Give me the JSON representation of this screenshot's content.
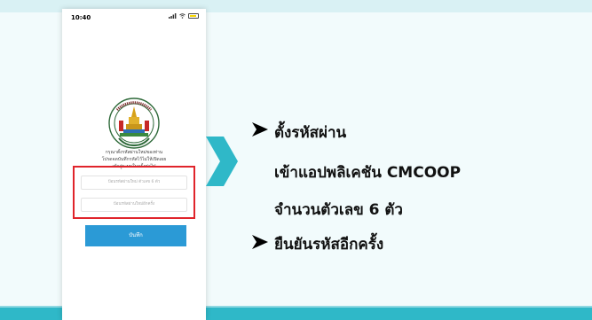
{
  "status_bar": {
    "time": "10:40"
  },
  "form": {
    "instruction_lines": [
      "กรุณาตั้งรหัสผ่านใหม่ของท่าน",
      "โปรดจดบันทึกรหัสไว้ไม่ให้เปิดเผย",
      "เข้าสู่ระบบในครั้งต่อไป"
    ],
    "password_placeholder": "ป้อนรหัสผ่านใหม่ ตัวเลข 6 ตัว",
    "confirm_placeholder": "ป้อนรหัสผ่านใหม่อีกครั้ง",
    "save_label": "บันทึก"
  },
  "steps": {
    "step1_line1": "ตั้งรหัสผ่าน",
    "step1_line2": "เข้าแอปพลิเคชัน CMCOOP",
    "step1_line3": "จำนวนตัวเลข 6 ตัว",
    "step2": "ยืนยันรหัสอีกครั้ง"
  },
  "colors": {
    "accent_teal": "#2fb8c8",
    "button_blue": "#2b9ad6",
    "highlight_red": "#e0242b"
  }
}
